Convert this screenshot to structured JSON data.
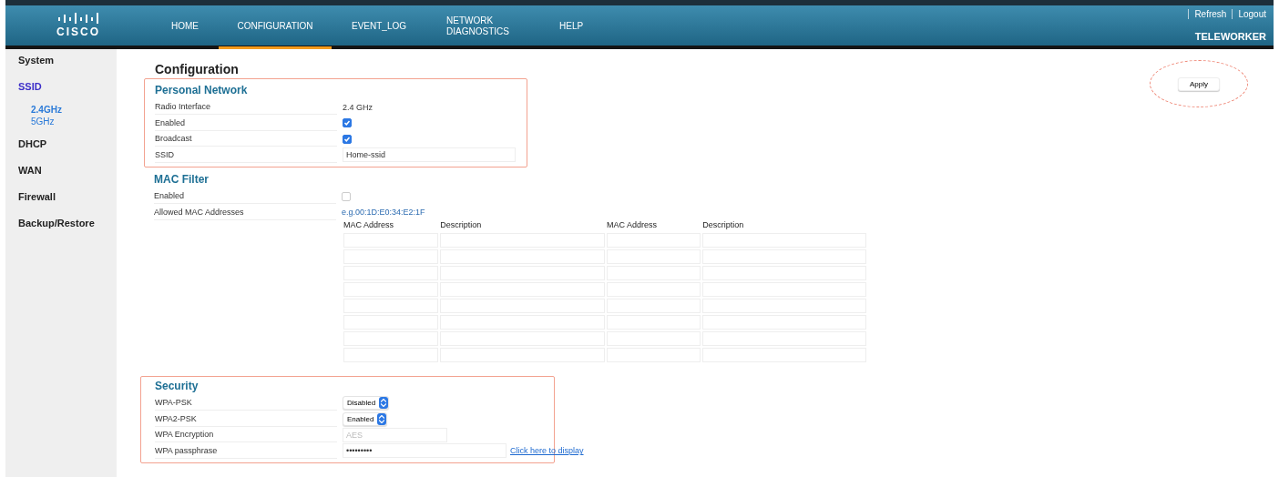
{
  "header": {
    "logo": "CISCO",
    "nav": [
      {
        "label": "HOME",
        "selected": false
      },
      {
        "label": "CONFIGURATION",
        "selected": true
      },
      {
        "label": "EVENT_LOG",
        "selected": false
      },
      {
        "label": "NETWORK DIAGNOSTICS",
        "selected": false
      },
      {
        "label": "HELP",
        "selected": false
      }
    ],
    "links": [
      "Refresh",
      "Logout"
    ],
    "user": "TELEWORKER"
  },
  "sidebar": {
    "items": [
      {
        "label": "System",
        "selected": false
      },
      {
        "label": "SSID",
        "selected": true,
        "children": [
          {
            "label": "2.4GHz",
            "selected": true
          },
          {
            "label": "5GHz",
            "selected": false
          }
        ]
      },
      {
        "label": "DHCP",
        "selected": false
      },
      {
        "label": "WAN",
        "selected": false
      },
      {
        "label": "Firewall",
        "selected": false
      },
      {
        "label": "Backup/Restore",
        "selected": false
      }
    ]
  },
  "page_title": "Configuration",
  "apply_button": "Apply",
  "personal_network": {
    "title": "Personal Network",
    "rows": [
      {
        "kind": "text",
        "label": "Radio Interface",
        "value": "2.4 GHz"
      },
      {
        "kind": "checkbox",
        "label": "Enabled",
        "checked": true
      },
      {
        "kind": "checkbox",
        "label": "Broadcast",
        "checked": true
      },
      {
        "kind": "input",
        "label": "SSID",
        "value": "Home-ssid",
        "disabled": false
      }
    ]
  },
  "mac_filter": {
    "title": "MAC Filter",
    "rows": [
      {
        "kind": "checkbox",
        "label": "Enabled",
        "checked": false
      },
      {
        "kind": "hint",
        "label": "Allowed MAC Addresses",
        "value": "e.g.00:1D:E0:34:E2:1F"
      }
    ],
    "table": {
      "columns": [
        "MAC Address",
        "Description",
        "MAC Address",
        "Description"
      ]
    }
  },
  "security": {
    "title": "Security",
    "rows": [
      {
        "kind": "select",
        "label": "WPA-PSK",
        "value": "Disabled"
      },
      {
        "kind": "select",
        "label": "WPA2-PSK",
        "value": "Enabled"
      },
      {
        "kind": "input",
        "label": "WPA Encryption",
        "value": "AES",
        "disabled": true
      },
      {
        "kind": "password",
        "label": "WPA passphrase",
        "value": "•••••••••",
        "link": "Click here to display"
      }
    ]
  }
}
